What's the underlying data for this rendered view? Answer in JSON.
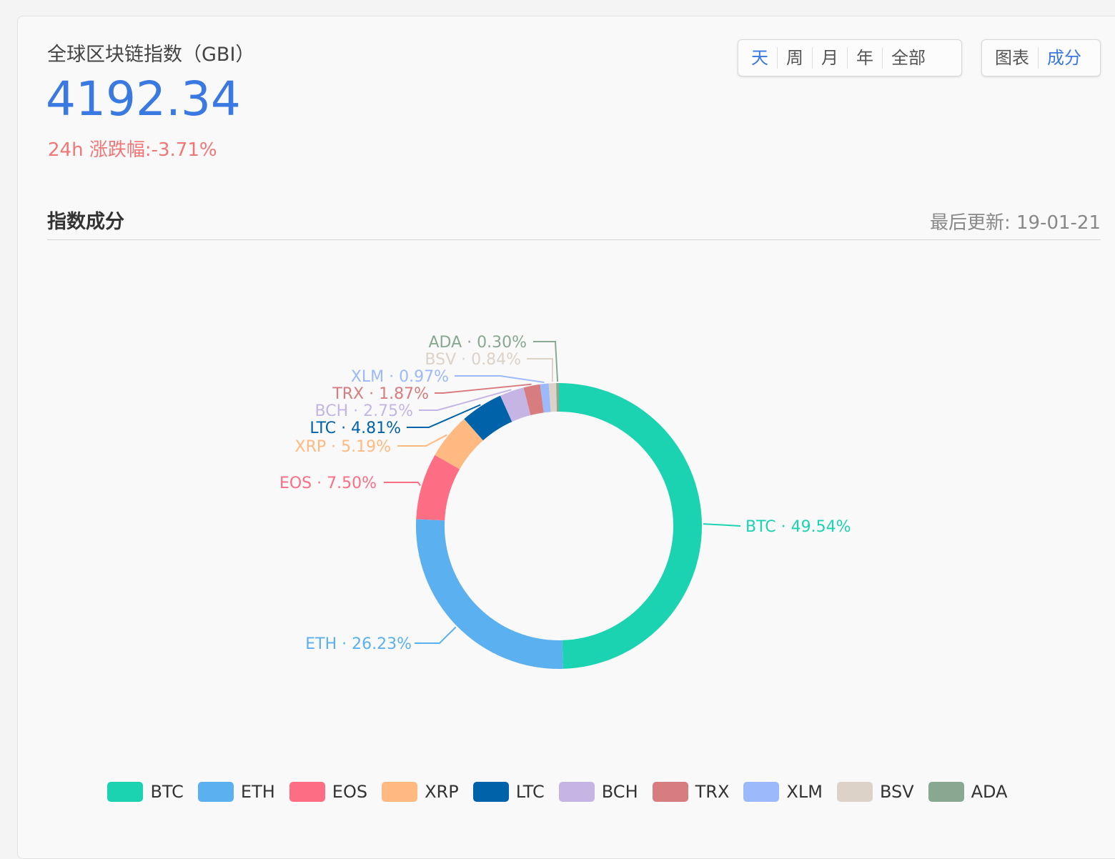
{
  "header": {
    "title": "全球区块链指数（GBI）",
    "value": "4192.34",
    "change": "24h 涨跌幅:-3.71%"
  },
  "range_buttons": [
    "天",
    "周",
    "月",
    "年",
    "全部"
  ],
  "range_active": "天",
  "view_buttons": [
    "图表",
    "成分"
  ],
  "view_active": "成分",
  "section": {
    "title": "指数成分",
    "updated": "最后更新: 19-01-21"
  },
  "colors": {
    "accent": "#3a78e2",
    "negative": "#f17676"
  },
  "chart_data": {
    "type": "pie",
    "style": "donut",
    "title": "",
    "legend_position": "bottom",
    "label_separator": " · ",
    "slices": [
      {
        "name": "BTC",
        "value": 49.54,
        "label": "49.54%",
        "color": "#1cd3b1"
      },
      {
        "name": "ETH",
        "value": 26.23,
        "label": "26.23%",
        "color": "#5bb0f0"
      },
      {
        "name": "EOS",
        "value": 7.5,
        "label": "7.50%",
        "color": "#fd6e85"
      },
      {
        "name": "XRP",
        "value": 5.19,
        "label": "5.19%",
        "color": "#ffb981"
      },
      {
        "name": "LTC",
        "value": 4.81,
        "label": "4.81%",
        "color": "#0062a8"
      },
      {
        "name": "BCH",
        "value": 2.75,
        "label": "2.75%",
        "color": "#c4b5e4"
      },
      {
        "name": "TRX",
        "value": 1.87,
        "label": "1.87%",
        "color": "#d77c7f"
      },
      {
        "name": "XLM",
        "value": 0.97,
        "label": "0.97%",
        "color": "#9cb9fb"
      },
      {
        "name": "BSV",
        "value": 0.84,
        "label": "0.84%",
        "color": "#dcd2c8"
      },
      {
        "name": "ADA",
        "value": 0.3,
        "label": "0.30%",
        "color": "#88a891"
      }
    ]
  }
}
